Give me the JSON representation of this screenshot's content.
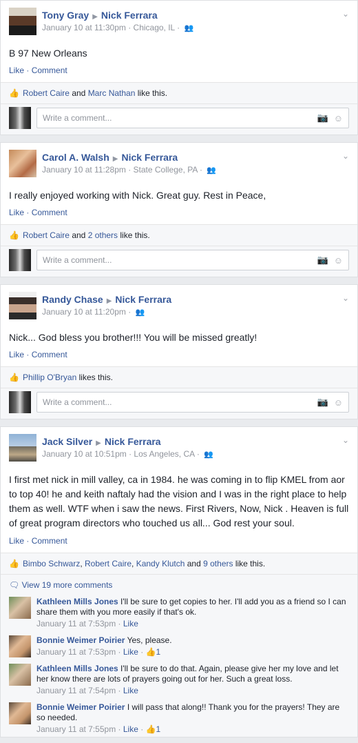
{
  "posts": [
    {
      "author": "Tony Gray",
      "target": "Nick Ferrara",
      "time": "January 10 at 11:30pm",
      "location": "Chicago, IL",
      "text": "B 97 New Orleans",
      "like_label": "Like",
      "comment_label": "Comment",
      "likers": [
        "Robert Caire",
        "Marc Nathan"
      ],
      "likes_suffix": "like this.",
      "comment_placeholder": "Write a comment..."
    },
    {
      "author": "Carol A. Walsh",
      "target": "Nick Ferrara",
      "time": "January 10 at 11:28pm",
      "location": "State College, PA",
      "text": "I really enjoyed working with Nick. Great guy. Rest in Peace,",
      "like_label": "Like",
      "comment_label": "Comment",
      "liker": "Robert Caire",
      "others": "2 others",
      "likes_suffix": "like this.",
      "comment_placeholder": "Write a comment..."
    },
    {
      "author": "Randy Chase",
      "target": "Nick Ferrara",
      "time": "January 10 at 11:20pm",
      "text": "Nick... God bless you brother!!! You will be missed greatly!",
      "like_label": "Like",
      "comment_label": "Comment",
      "liker": "Phillip O'Bryan",
      "likes_suffix": "likes this.",
      "comment_placeholder": "Write a comment..."
    },
    {
      "author": "Jack Silver",
      "target": "Nick Ferrara",
      "time": "January 10 at 10:51pm",
      "location": "Los Angeles, CA",
      "text": "I first met nick in mill valley, ca in 1984. he was coming in to flip KMEL from aor to top 40! he and keith naftaly had the vision and I was in the right place to help them as well. WTF when i saw the news. First Rivers, Now, Nick . Heaven is full of great program directors who touched us all... God rest your soul.",
      "like_label": "Like",
      "comment_label": "Comment",
      "likers": [
        "Bimbo Schwarz",
        "Robert Caire",
        "Kandy Klutch"
      ],
      "others": "9 others",
      "likes_suffix": "like this.",
      "view_more": "View 19 more comments",
      "comments": [
        {
          "name": "Kathleen Mills Jones",
          "text": "I'll be sure to get copies to her. I'll add you as a friend so I can share them with you more easily if that's ok.",
          "time": "January 11 at 7:53pm",
          "like": "Like",
          "count": ""
        },
        {
          "name": "Bonnie Weimer Poirier",
          "text": "Yes, please.",
          "time": "January 11 at 7:53pm",
          "like": "Like",
          "count": "1"
        },
        {
          "name": "Kathleen Mills Jones",
          "text": "I'll be sure to do that. Again, please give her my love and let her know there are lots of prayers going out for her. Such a great loss.",
          "time": "January 11 at 7:54pm",
          "like": "Like",
          "count": ""
        },
        {
          "name": "Bonnie Weimer Poirier",
          "text": "I will pass that along!! Thank you for the prayers! They are so needed.",
          "time": "January 11 at 7:55pm",
          "like": "Like",
          "count": "1"
        }
      ]
    }
  ]
}
